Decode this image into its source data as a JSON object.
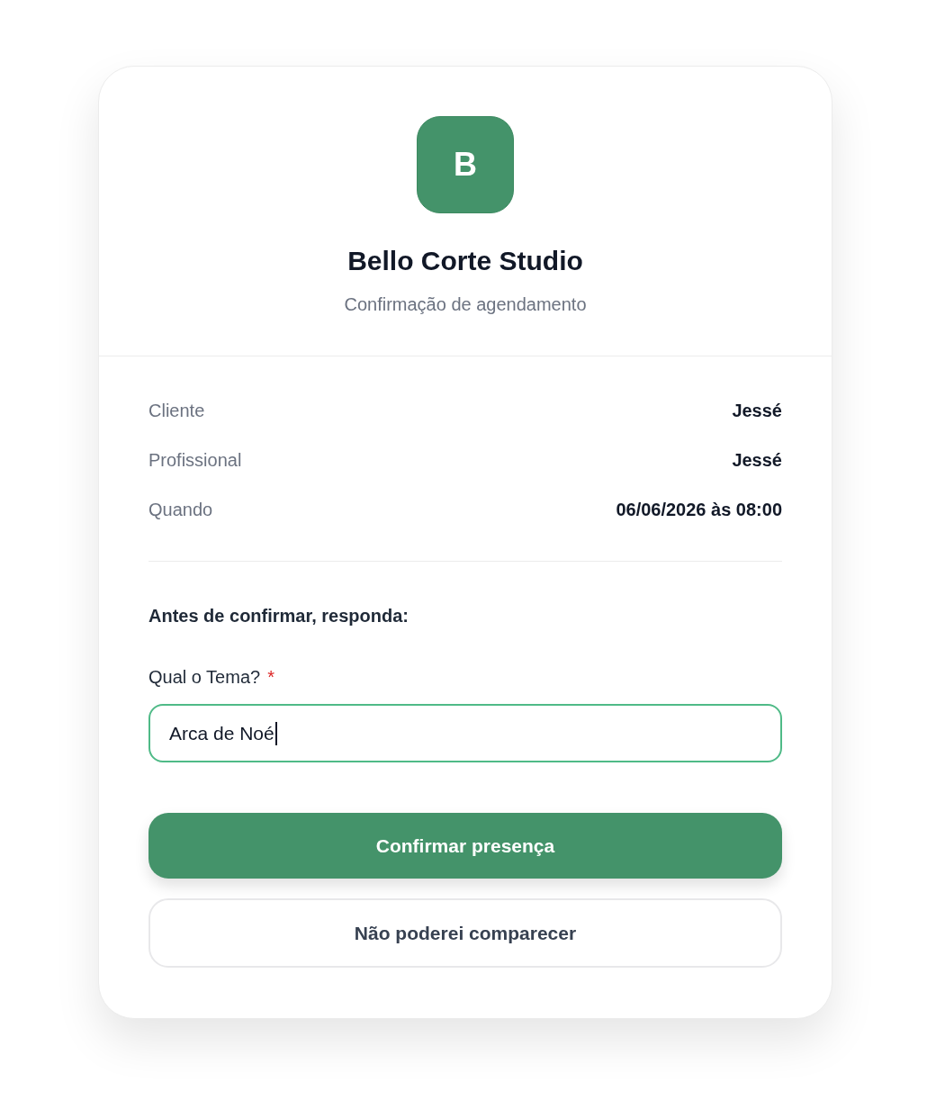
{
  "header": {
    "logo_letter": "B",
    "title": "Bello Corte Studio",
    "subtitle": "Confirmação de agendamento"
  },
  "details": [
    {
      "label": "Cliente",
      "value": "Jessé"
    },
    {
      "label": "Profissional",
      "value": "Jessé"
    },
    {
      "label": "Quando",
      "value": "06/06/2026 às 08:00"
    }
  ],
  "question_section": {
    "heading": "Antes de confirmar, responda:",
    "fields": [
      {
        "label": "Qual o Tema?",
        "required_mark": "*",
        "value": "Arca de Noé",
        "focused": true
      }
    ]
  },
  "buttons": [
    {
      "kind": "primary",
      "label": "Confirmar presença"
    },
    {
      "kind": "secondary",
      "label": "Não poderei comparecer"
    }
  ]
}
